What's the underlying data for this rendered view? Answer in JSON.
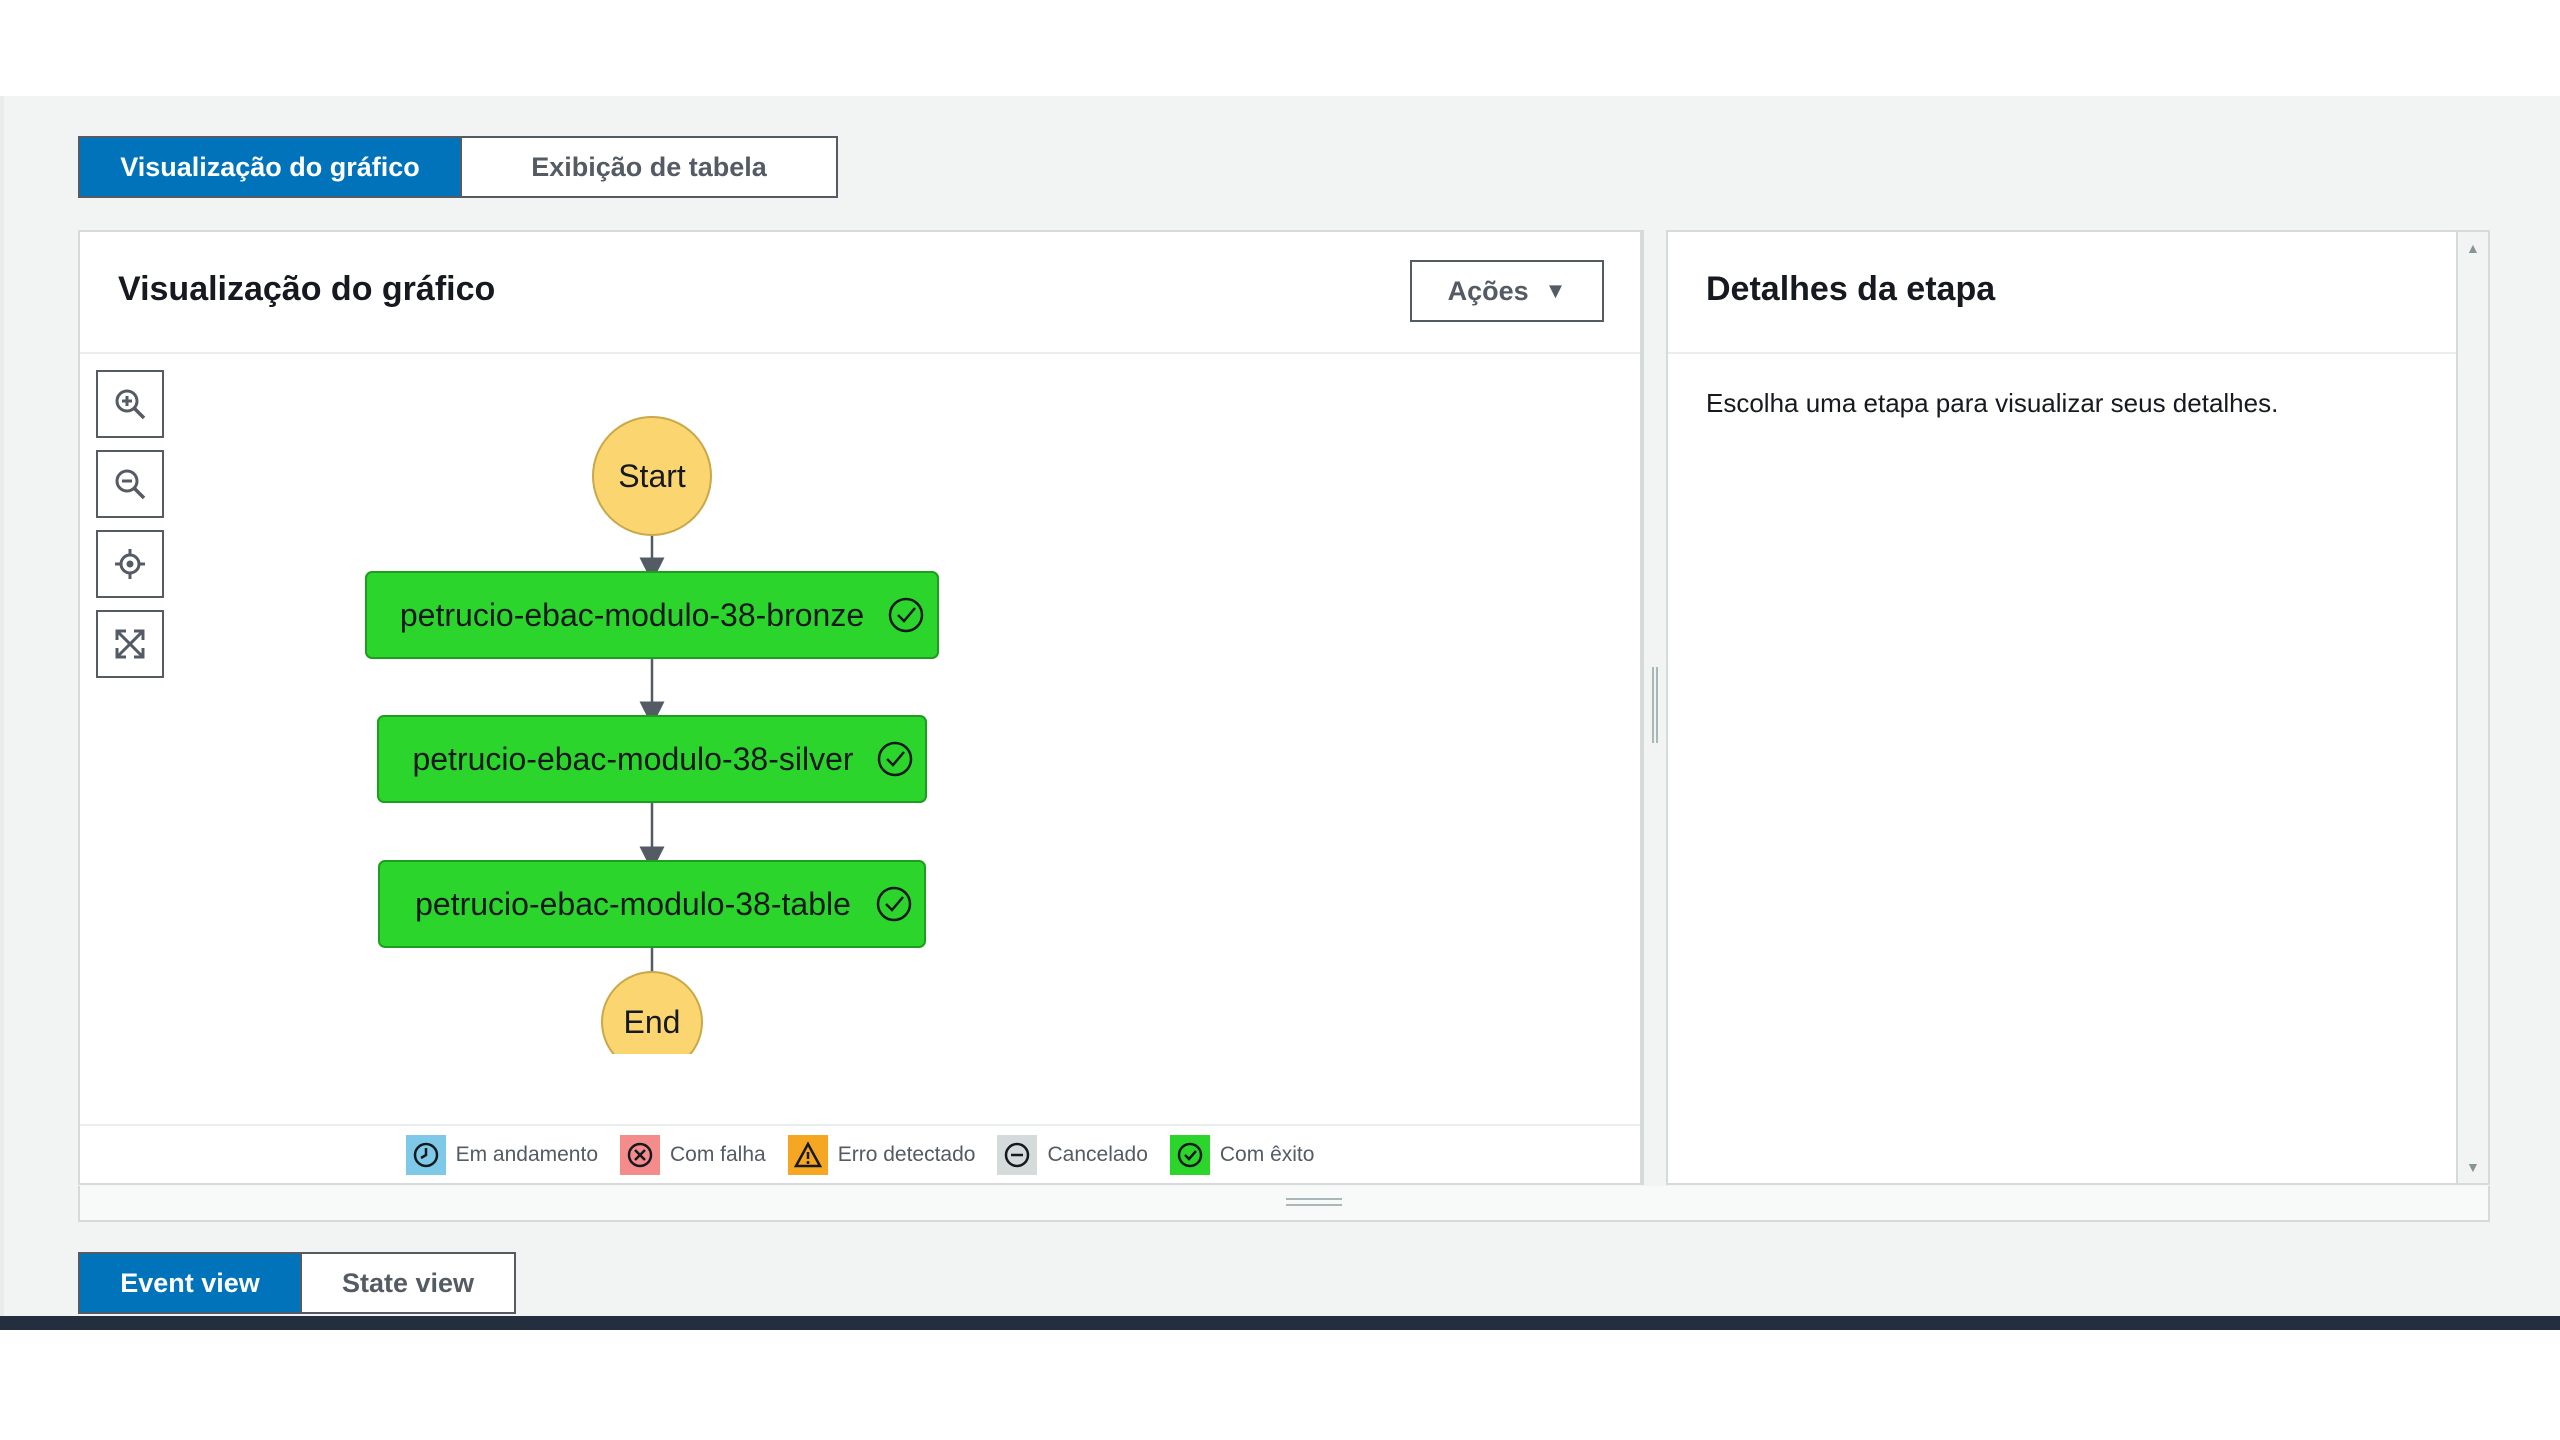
{
  "view_toggle": {
    "graph_label": "Visualização do gráfico",
    "table_label": "Exibição de tabela"
  },
  "graph_panel": {
    "title": "Visualização do gráfico",
    "actions_label": "Ações",
    "nodes": {
      "start": "Start",
      "steps": [
        "petrucio-ebac-modulo-38-bronze",
        "petrucio-ebac-modulo-38-silver",
        "petrucio-ebac-modulo-38-table"
      ],
      "end": "End"
    },
    "step_status": "succeeded",
    "legend": [
      "Em andamento",
      "Com falha",
      "Erro detectado",
      "Cancelado",
      "Com êxito"
    ]
  },
  "details_panel": {
    "title": "Detalhes da etapa",
    "text": "Escolha uma etapa para visualizar seus detalhes."
  },
  "bottom_toggle": {
    "event_label": "Event view",
    "state_label": "State view"
  },
  "colors": {
    "primary": "#0073bb",
    "success_node": "#2bd52b",
    "terminal_node": "#fbd570",
    "in_progress": "#7fc9e8",
    "failed": "#f48c8c",
    "caught_error": "#f5a623",
    "cancelled": "#d5dbdb",
    "succeeded": "#2bd52b",
    "bottom_bar": "#232f3e"
  }
}
